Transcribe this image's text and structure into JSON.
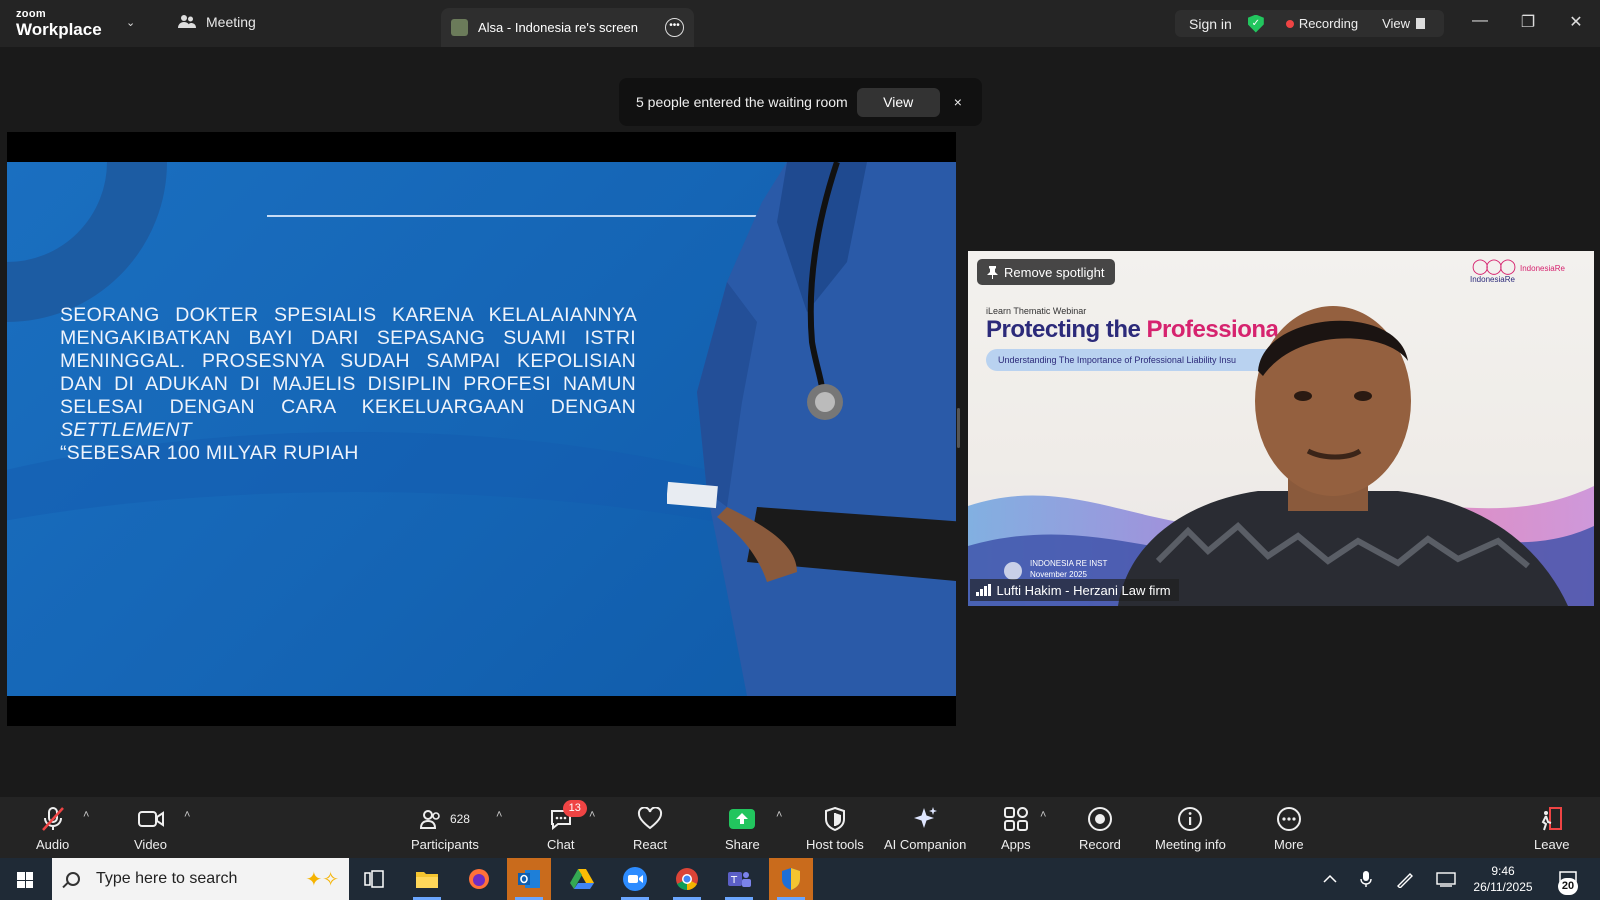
{
  "app": {
    "logo_line1": "zoom",
    "logo_line2": "Workplace",
    "meeting_tab": "Meeting",
    "screen_tab": "Alsa - Indonesia re's screen",
    "sign_in": "Sign in",
    "recording": "Recording",
    "view": "View"
  },
  "notification": {
    "text": "5 people entered the waiting room",
    "view_button": "View",
    "close": "×"
  },
  "slide": {
    "lines": [
      "SEORANG DOKTER SPESIALIS KARENA KELALAIANNYA",
      "MENGAKIBATKAN BAYI DARI SEPASANG SUAMI ISTRI",
      "MENINGGAL. PROSESNYA SUDAH SAMPAI KEPOLISIAN DAN",
      "DI ADUKAN DI MAJELIS DISIPLIN PROFESI NAMUN SELESAI"
    ],
    "line5_prefix": "DENGAN CARA KEKELUARGAAN DENGAN ",
    "line5_italic": "SETTLEMENT",
    "line6": "“SEBESAR 100 MILYAR RUPIAH"
  },
  "video": {
    "remove_spotlight": "Remove spotlight",
    "webinar_label": "iLearn Thematic Webinar",
    "title_part1": "Protecting the ",
    "title_part2": "Professiona",
    "pill": "Understanding The Importance of Professional Liability Insu",
    "logo1": "IndonesiaRe",
    "logo2": "IndonesiaRe",
    "inst_line1": "INDONESIA RE INST",
    "inst_line2": "November 2025",
    "name": "Lufti Hakim - Herzani Law firm"
  },
  "toolbar": {
    "audio": "Audio",
    "video": "Video",
    "participants": "Participants",
    "participants_count": "628",
    "chat": "Chat",
    "chat_badge": "13",
    "react": "React",
    "share": "Share",
    "host_tools": "Host tools",
    "ai_companion": "AI Companion",
    "apps": "Apps",
    "record": "Record",
    "meeting_info": "Meeting info",
    "more": "More",
    "leave": "Leave"
  },
  "taskbar": {
    "search_placeholder": "Type here to search",
    "time": "9:46",
    "date": "26/11/2025",
    "notifications": "20"
  },
  "colors": {
    "accent_green": "#22c55e",
    "record_red": "#ef4444",
    "slide_blue": "#1565b5"
  }
}
